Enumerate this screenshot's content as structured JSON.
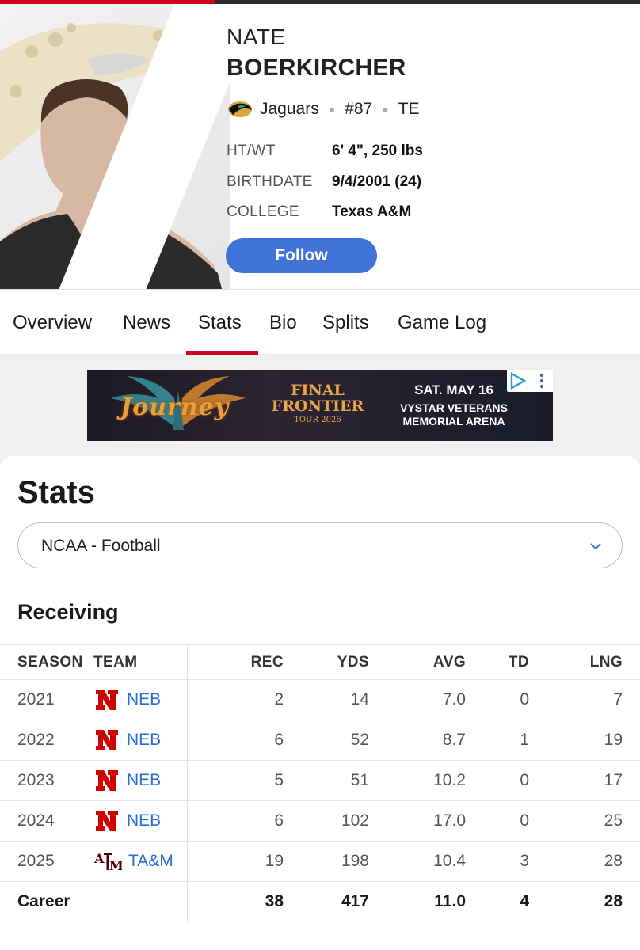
{
  "player": {
    "first_name": "NATE",
    "last_name": "BOERKIRCHER",
    "team": "Jaguars",
    "number": "#87",
    "position": "TE",
    "info": [
      {
        "label": "HT/WT",
        "value": "6' 4\", 250 lbs"
      },
      {
        "label": "BIRTHDATE",
        "value": "9/4/2001 (24)"
      },
      {
        "label": "COLLEGE",
        "value": "Texas A&M"
      }
    ],
    "follow_label": "Follow"
  },
  "tabs": [
    {
      "label": "Overview"
    },
    {
      "label": "News"
    },
    {
      "label": "Stats",
      "active": true
    },
    {
      "label": "Bio"
    },
    {
      "label": "Splits"
    },
    {
      "label": "Game Log"
    }
  ],
  "ad": {
    "logo": "Journey",
    "title": "FINAL FRONTIER",
    "subtitle": "TOUR 2026",
    "date": "SAT. MAY 16",
    "venue": "VYSTAR VETERANS MEMORIAL ARENA"
  },
  "stats": {
    "title": "Stats",
    "league_select": "NCAA - Football",
    "section": "Receiving",
    "columns": [
      "SEASON",
      "TEAM",
      "REC",
      "YDS",
      "AVG",
      "TD",
      "LNG"
    ],
    "rows": [
      {
        "season": "2021",
        "team": "NEB",
        "logo": "N",
        "rec": "2",
        "yds": "14",
        "avg": "7.0",
        "td": "0",
        "lng": "7"
      },
      {
        "season": "2022",
        "team": "NEB",
        "logo": "N",
        "rec": "6",
        "yds": "52",
        "avg": "8.7",
        "td": "1",
        "lng": "19"
      },
      {
        "season": "2023",
        "team": "NEB",
        "logo": "N",
        "rec": "5",
        "yds": "51",
        "avg": "10.2",
        "td": "0",
        "lng": "17"
      },
      {
        "season": "2024",
        "team": "NEB",
        "logo": "N",
        "rec": "6",
        "yds": "102",
        "avg": "17.0",
        "td": "0",
        "lng": "25"
      },
      {
        "season": "2025",
        "team": "TA&M",
        "logo": "ATM",
        "rec": "19",
        "yds": "198",
        "avg": "10.4",
        "td": "3",
        "lng": "28"
      }
    ],
    "career": {
      "label": "Career",
      "rec": "38",
      "yds": "417",
      "avg": "11.0",
      "td": "4",
      "lng": "28"
    }
  },
  "colors": {
    "accent_red": "#d0021b",
    "follow_blue": "#3f73d8",
    "link_blue": "#2a6fcf",
    "neb_red": "#d00000",
    "tamu_maroon": "#500000"
  }
}
